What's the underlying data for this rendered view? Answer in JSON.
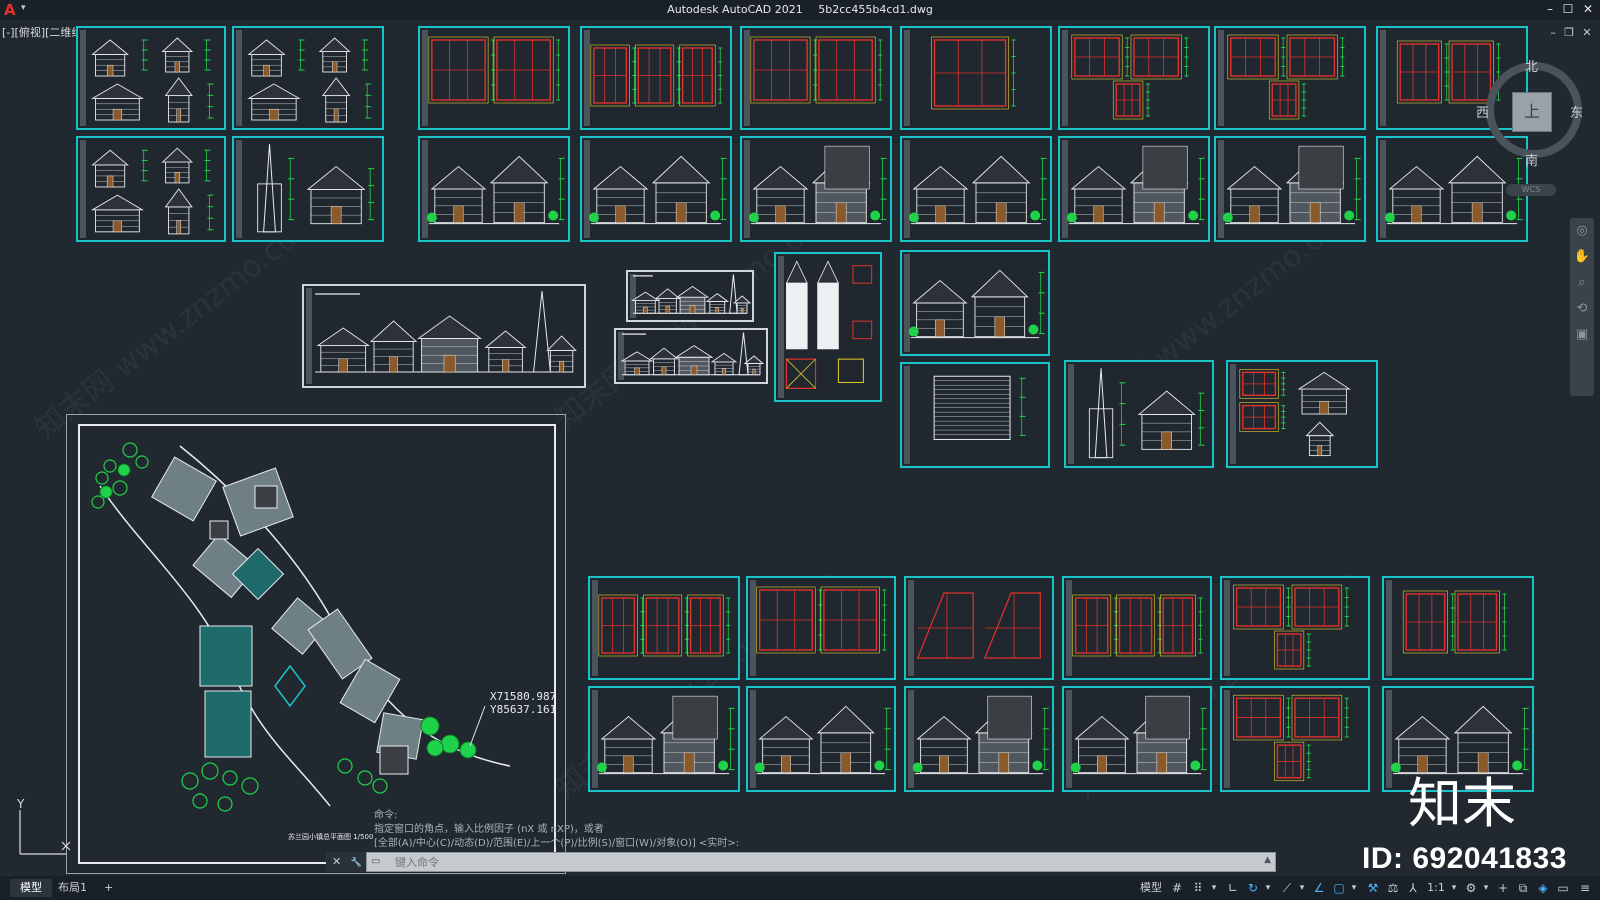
{
  "window": {
    "app_name": "Autodesk AutoCAD 2021",
    "file_name": "5b2cc455b4cd1.dwg",
    "minimize": "–",
    "maximize": "☐",
    "close": "✕",
    "doc_minimize": "–",
    "doc_restore": "❐",
    "doc_close": "✕"
  },
  "viewport": {
    "label": "[-][俯视][二维线框]"
  },
  "viewcube": {
    "north": "北",
    "south": "南",
    "east": "东",
    "west": "西",
    "top_face": "上",
    "wcs_label": "WCS"
  },
  "site_plan": {
    "coord_x": "X71580.987",
    "coord_y": "Y85637.161",
    "title": "苏兰园小镇总平面图  1/500"
  },
  "ucs": {
    "y_label": "Y"
  },
  "command": {
    "history": [
      "命令: ",
      "指定窗口的角点，输入比例因子 (nX 或 nXP)，或者",
      "[全部(A)/中心(C)/动态(D)/范围(E)/上一个(P)/比例(S)/窗口(W)/对象(O)] <实时>:"
    ],
    "placeholder": "键入命令",
    "close_icon": "✕",
    "config_icon": "🔧",
    "prompt_icon": "▭"
  },
  "tabs": [
    {
      "label": "模型",
      "active": true
    },
    {
      "label": "布局1",
      "active": false
    },
    {
      "label": "+",
      "active": false
    }
  ],
  "status_bar": {
    "model_label": "模型",
    "scale_label": "1:1"
  },
  "watermark": {
    "id_text": "ID: 692041833",
    "logo_text": "知末",
    "diagonal_text": "知末网 www.znzmo.com"
  },
  "colors": {
    "background": "#212830",
    "sheet_border": "#19c3c8",
    "plan_red": "#e0322b",
    "plan_yellow": "#e3d22a",
    "dimension_green": "#20d14a",
    "status_active": "#4ab4ff"
  }
}
